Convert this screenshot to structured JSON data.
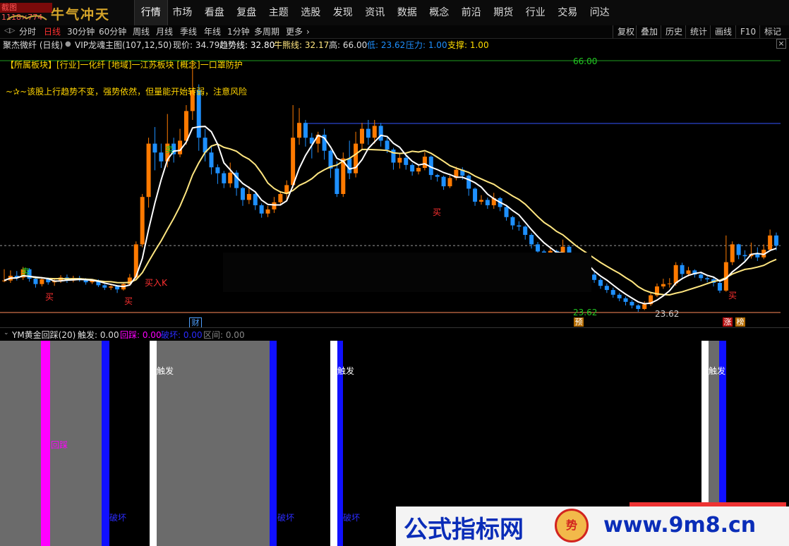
{
  "window_badge": "截图1118×774",
  "logo": {
    "text": "牛气冲天"
  },
  "nav": [
    "行情",
    "市场",
    "看盘",
    "复盘",
    "主题",
    "选股",
    "发现",
    "资讯",
    "数据",
    "概念",
    "前沿",
    "期货",
    "行业",
    "交易",
    "问达"
  ],
  "nav_active": "行情",
  "periods": [
    "分时",
    "日线",
    "30分钟",
    "60分钟",
    "周线",
    "月线",
    "季线",
    "年线",
    "1分钟",
    "多周期",
    "更多"
  ],
  "period_active": "日线",
  "tools": [
    "复权",
    "叠加",
    "历史",
    "统计",
    "画线",
    "F10",
    "标记"
  ],
  "info": {
    "stock": "聚杰微纤 (日线)",
    "indicator": "VIP龙魂主图(107,12,50)",
    "price_label": "现价: 34.79",
    "trend_label": "趋势线: 32.80",
    "bull_label": "牛熊线: 32.17",
    "high_label": "高: 66.00",
    "low_label": "低: 23.62",
    "pressure_label": "压力: 1.00",
    "support_label": "支撑: 1.00"
  },
  "annotations": {
    "sector_line": "【所属板块】[行业]一化纤 [地域]一江苏板块 [概念]一口罩防护",
    "comment": "~✰~该股上行趋势不变，强势依然，但量能开始转弱，注意风险",
    "high_value": "66.00",
    "low_value": "23.62",
    "low_value_2": "23.62",
    "tag_cai": "财",
    "tag_yu": "预",
    "tag_zhang": "涨",
    "tag_bang": "榜",
    "sell": "卖",
    "buy": "买",
    "buy_k": "买入K"
  },
  "sub": {
    "name": "YM黄金回踩(20)",
    "trigger_label": "触发: 0.00",
    "pullback_label": "回踩: 0.00",
    "break_label": "破坏: 0.00",
    "range_label": "区间: 0.00",
    "trigger": "触发",
    "pullback": "回踩",
    "broken": "破坏"
  },
  "watermark": {
    "text": "公式指标网",
    "url": "www.9m8.cn",
    "logo": "势"
  },
  "colors": {
    "up": "#ff7a00",
    "down": "#1e90ff",
    "trend": "#ffffff",
    "bull": "#ffe680",
    "magenta": "#ff00ff",
    "blue": "#1010ff"
  },
  "chart_data": {
    "type": "candlestick",
    "high": 66.0,
    "low": 23.62,
    "current": 34.79,
    "trend_line": 32.8,
    "bull_bear_line": 32.17,
    "candles": [
      [
        28.8,
        28.9,
        28.6,
        30.8
      ],
      [
        28.9,
        29.7,
        28.5,
        30.6
      ],
      [
        29.7,
        29.4,
        28.9,
        30.5
      ],
      [
        29.4,
        30.8,
        29.0,
        31.2
      ],
      [
        30.8,
        29.2,
        28.7,
        31.0
      ],
      [
        29.2,
        28.3,
        27.7,
        29.6
      ],
      [
        28.3,
        29.1,
        27.9,
        29.5
      ],
      [
        29.1,
        28.6,
        28.2,
        29.4
      ],
      [
        28.6,
        28.8,
        28.0,
        29.3
      ],
      [
        28.8,
        29.4,
        28.5,
        29.8
      ],
      [
        29.4,
        28.9,
        28.5,
        29.9
      ],
      [
        28.9,
        29.3,
        28.6,
        29.7
      ],
      [
        29.3,
        29.0,
        28.7,
        29.7
      ],
      [
        29.0,
        28.6,
        28.2,
        29.3
      ],
      [
        28.6,
        28.9,
        28.3,
        29.1
      ],
      [
        28.9,
        28.1,
        27.8,
        29.1
      ],
      [
        28.1,
        27.7,
        27.3,
        28.3
      ],
      [
        27.7,
        27.9,
        27.3,
        28.2
      ],
      [
        27.9,
        27.4,
        26.8,
        28.1
      ],
      [
        27.4,
        28.3,
        27.2,
        28.5
      ],
      [
        28.3,
        29.4,
        28.0,
        30.0
      ],
      [
        29.4,
        35.0,
        29.1,
        35.5
      ],
      [
        35.0,
        43.0,
        34.5,
        43.5
      ],
      [
        43.0,
        52.0,
        41.2,
        53.0
      ],
      [
        52.0,
        50.5,
        47.5,
        54.8
      ],
      [
        50.5,
        49.0,
        47.9,
        52.0
      ],
      [
        49.0,
        52.0,
        48.0,
        57.0
      ],
      [
        52.0,
        50.2,
        48.8,
        53.0
      ],
      [
        50.2,
        52.5,
        49.7,
        54.5
      ],
      [
        52.5,
        57.5,
        51.8,
        58.5
      ],
      [
        57.5,
        61.0,
        56.0,
        66.0
      ],
      [
        61.0,
        53.0,
        50.8,
        62.0
      ],
      [
        53.0,
        50.5,
        49.0,
        54.5
      ],
      [
        50.5,
        48.0,
        46.8,
        51.6
      ],
      [
        48.0,
        47.0,
        45.2,
        48.5
      ],
      [
        47.0,
        45.3,
        44.5,
        47.4
      ],
      [
        45.3,
        47.1,
        44.6,
        48.8
      ],
      [
        47.1,
        44.5,
        43.2,
        47.5
      ],
      [
        44.5,
        42.5,
        41.5,
        44.7
      ],
      [
        42.5,
        43.5,
        41.8,
        44.8
      ],
      [
        43.5,
        41.6,
        40.8,
        43.7
      ],
      [
        41.6,
        40.2,
        39.5,
        41.9
      ],
      [
        40.2,
        40.9,
        39.6,
        41.5
      ],
      [
        40.9,
        42.1,
        40.3,
        43.0
      ],
      [
        42.1,
        43.5,
        41.6,
        44.0
      ],
      [
        43.5,
        45.0,
        42.4,
        45.8
      ],
      [
        45.0,
        53.0,
        44.5,
        58.5
      ],
      [
        53.0,
        55.5,
        51.8,
        58.0
      ],
      [
        55.5,
        53.0,
        51.5,
        56.0
      ],
      [
        53.0,
        52.0,
        49.5,
        53.8
      ],
      [
        52.0,
        53.5,
        50.5,
        54.0
      ],
      [
        53.5,
        50.8,
        49.3,
        54.5
      ],
      [
        50.8,
        47.8,
        46.2,
        51.0
      ],
      [
        47.8,
        43.5,
        43.0,
        49.0
      ],
      [
        43.5,
        49.5,
        43.0,
        50.5
      ],
      [
        49.5,
        47.0,
        46.0,
        52.5
      ],
      [
        47.0,
        52.0,
        46.3,
        54.0
      ],
      [
        52.0,
        54.5,
        51.0,
        55.5
      ],
      [
        54.5,
        53.0,
        51.8,
        56.0
      ],
      [
        53.0,
        55.0,
        52.0,
        56.0
      ],
      [
        55.0,
        52.5,
        51.5,
        55.5
      ],
      [
        52.5,
        51.0,
        50.4,
        53.0
      ],
      [
        51.0,
        48.8,
        47.6,
        51.3
      ],
      [
        48.8,
        49.6,
        47.8,
        50.4
      ],
      [
        49.6,
        48.4,
        47.6,
        50.1
      ],
      [
        48.4,
        47.3,
        46.6,
        48.7
      ],
      [
        47.3,
        47.9,
        46.8,
        48.4
      ],
      [
        47.9,
        49.8,
        47.5,
        50.6
      ],
      [
        49.8,
        46.7,
        45.9,
        50.0
      ],
      [
        46.7,
        46.4,
        45.6,
        46.9
      ],
      [
        46.4,
        44.8,
        44.2,
        46.6
      ],
      [
        44.8,
        46.2,
        44.5,
        46.6
      ],
      [
        46.2,
        47.6,
        45.8,
        48.1
      ],
      [
        47.6,
        46.6,
        45.9,
        48.0
      ],
      [
        46.6,
        44.4,
        43.2,
        46.8
      ],
      [
        44.4,
        42.2,
        41.5,
        44.6
      ],
      [
        42.2,
        42.5,
        41.7,
        43.3
      ],
      [
        42.5,
        41.6,
        41.0,
        42.9
      ],
      [
        41.6,
        42.8,
        41.0,
        43.7
      ],
      [
        42.8,
        41.3,
        40.6,
        43.0
      ],
      [
        41.3,
        39.6,
        39.0,
        41.5
      ],
      [
        39.6,
        38.2,
        37.5,
        39.8
      ],
      [
        38.2,
        38.0,
        37.3,
        38.9
      ],
      [
        38.0,
        36.6,
        35.8,
        38.2
      ],
      [
        36.6,
        35.0,
        34.3,
        36.9
      ],
      [
        35.0,
        33.8,
        33.2,
        35.4
      ],
      [
        33.8,
        32.9,
        32.3,
        34.1
      ],
      [
        32.9,
        33.9,
        32.4,
        34.4
      ],
      [
        33.9,
        32.6,
        31.9,
        34.1
      ],
      [
        32.6,
        34.6,
        32.4,
        35.8
      ],
      [
        34.6,
        32.2,
        31.6,
        34.8
      ],
      [
        32.2,
        30.8,
        30.3,
        32.4
      ],
      [
        30.8,
        30.6,
        29.9,
        31.4
      ],
      [
        30.6,
        29.9,
        29.5,
        31.0
      ],
      [
        29.9,
        29.0,
        28.5,
        30.3
      ],
      [
        29.0,
        28.0,
        27.5,
        29.3
      ],
      [
        28.0,
        27.3,
        26.8,
        28.4
      ],
      [
        27.3,
        26.5,
        26.0,
        27.7
      ],
      [
        26.5,
        25.9,
        25.4,
        26.8
      ],
      [
        25.9,
        25.3,
        24.7,
        26.2
      ],
      [
        25.3,
        24.7,
        24.2,
        25.6
      ],
      [
        24.7,
        24.1,
        23.62,
        24.9
      ],
      [
        24.1,
        24.9,
        23.9,
        25.4
      ],
      [
        24.9,
        26.4,
        24.6,
        26.8
      ],
      [
        26.4,
        27.9,
        26.1,
        28.4
      ],
      [
        27.9,
        28.3,
        27.5,
        29.2
      ],
      [
        28.3,
        28.4,
        27.7,
        29.3
      ],
      [
        28.4,
        31.5,
        28.0,
        32.0
      ],
      [
        31.5,
        30.0,
        29.4,
        31.9
      ],
      [
        30.0,
        30.6,
        29.6,
        31.2
      ],
      [
        30.6,
        29.9,
        29.4,
        30.8
      ],
      [
        29.9,
        29.3,
        28.8,
        30.4
      ],
      [
        29.3,
        29.1,
        28.6,
        29.6
      ],
      [
        29.1,
        28.5,
        27.9,
        29.6
      ],
      [
        28.5,
        27.2,
        26.8,
        28.9
      ],
      [
        27.2,
        32.0,
        27.0,
        36.5
      ],
      [
        32.0,
        35.0,
        31.5,
        35.5
      ],
      [
        35.0,
        33.2,
        32.5,
        35.1
      ],
      [
        33.2,
        33.0,
        32.2,
        34.0
      ],
      [
        33.0,
        33.4,
        32.6,
        35.3
      ],
      [
        33.4,
        32.8,
        32.2,
        34.5
      ],
      [
        32.8,
        34.1,
        32.5,
        35.0
      ],
      [
        34.1,
        36.5,
        33.8,
        37.5
      ],
      [
        36.5,
        34.79,
        34.0,
        37.0
      ]
    ]
  }
}
